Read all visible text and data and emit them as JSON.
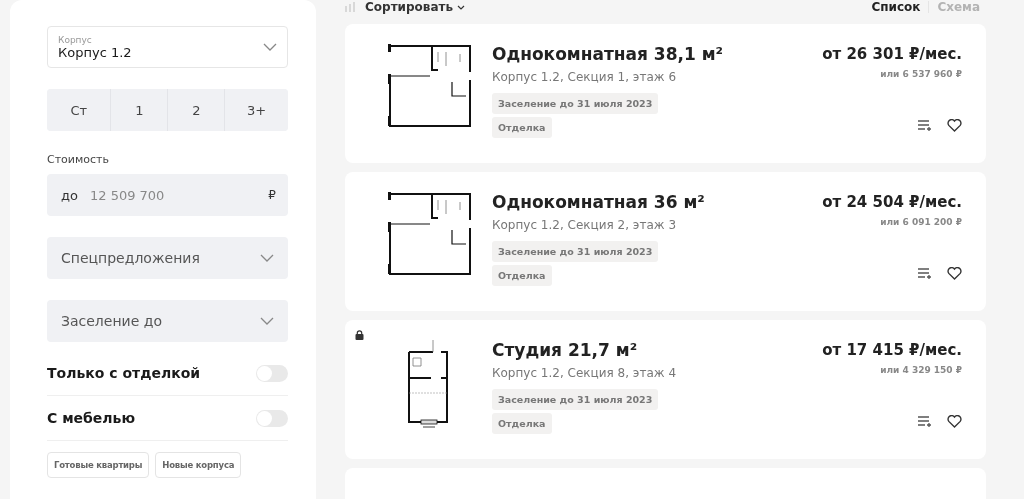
{
  "filters": {
    "building_select": {
      "label": "Корпус",
      "value": "Корпус 1.2"
    },
    "rooms": [
      {
        "label": "Ст",
        "selected": false
      },
      {
        "label": "1",
        "selected": false
      },
      {
        "label": "2",
        "selected": false
      },
      {
        "label": "3+",
        "selected": false
      }
    ],
    "price": {
      "label": "Стоимость",
      "prefix": "до",
      "placeholder": "12 509 700",
      "currency": "₽"
    },
    "dropdowns": [
      {
        "label": "Спецпредложения"
      },
      {
        "label": "Заселение до"
      }
    ],
    "toggles": [
      {
        "label": "Только с отделкой",
        "on": false
      },
      {
        "label": "С мебелью",
        "on": false
      }
    ],
    "chips": [
      {
        "label": "Готовые квартиры",
        "selected": false
      },
      {
        "label": "Новые корпуса",
        "selected": false
      }
    ]
  },
  "toolbar": {
    "sort": "Сортировать",
    "views": [
      {
        "label": "Список",
        "selected": true
      },
      {
        "label": "Схема",
        "selected": false
      }
    ]
  },
  "listings": [
    {
      "kind": "one-room",
      "locked": false,
      "title": "Однокомнатная 38,1 м²",
      "location": "Корпус 1.2, Секция 1, этаж 6",
      "tags": [
        "Заселение до 31 июля 2023",
        "Отделка"
      ],
      "monthly": "от 26 301 ₽/мес.",
      "total": "или 6 537 960 ₽"
    },
    {
      "kind": "one-room",
      "locked": false,
      "title": "Однокомнатная 36 м²",
      "location": "Корпус 1.2, Секция 2, этаж 3",
      "tags": [
        "Заселение до 31 июля 2023",
        "Отделка"
      ],
      "monthly": "от 24 504 ₽/мес.",
      "total": "или 6 091 200 ₽"
    },
    {
      "kind": "studio",
      "locked": true,
      "title": "Студия 21,7 м²",
      "location": "Корпус 1.2, Секция 8, этаж 4",
      "tags": [
        "Заселение до 31 июля 2023",
        "Отделка"
      ],
      "monthly": "от 17 415 ₽/мес.",
      "total": "или 4 329 150 ₽"
    }
  ]
}
